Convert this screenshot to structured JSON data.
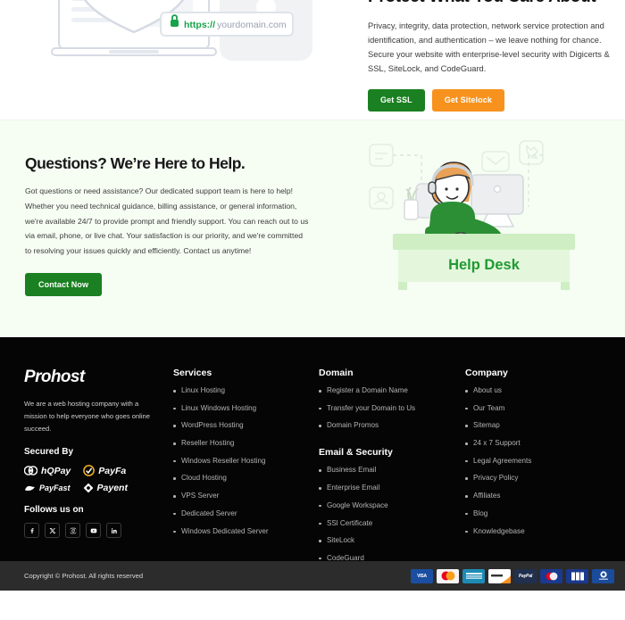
{
  "ssl_section": {
    "title": "Protect What You Care About",
    "paragraph": "Privacy, integrity, data protection, network service protection and identification, and authentication – we leave nothing for chance. Secure your website with enterprise-level security with Digicerts & SSL, SiteLock, and CodeGuard.",
    "primary_button": "Get SSL",
    "secondary_button": "Get Sitelock",
    "address_bar_text": "https://yourdomain.com",
    "address_bar_scheme": "https://",
    "address_bar_host": "yourdomain.com",
    "illustration_name": "laptop-shield-lock-illustration",
    "colors": {
      "primary": "#1a8021",
      "secondary": "#f7921e"
    }
  },
  "help_section": {
    "title": "Questions? We’re Here to Help.",
    "paragraph": "Got questions or need assistance? Our dedicated support team is here to help! Whether you need technical guidance, billing assistance, or general information, we're available 24/7 to provide prompt and friendly support. You can reach out to us via email, phone, or live chat. Your satisfaction is our priority, and we're committed to resolving your issues quickly and efficiently. Contact us anytime!",
    "button": "Contact Now",
    "desk_label": "Help Desk",
    "illustration_name": "help-desk-agent-illustration",
    "background": "#f6fdf3"
  },
  "footer": {
    "logo": "Prohost",
    "description": "We are a web hosting company with a mission to help everyone who goes online succeed.",
    "secured_by_heading": "Secured By",
    "secured_by": [
      {
        "name": "hqpay-logo",
        "label": "hQPay"
      },
      {
        "name": "payfa-logo",
        "label": "PayFa"
      },
      {
        "name": "payfast-logo",
        "label": "PayFast"
      },
      {
        "name": "payent-logo",
        "label": "Payent"
      }
    ],
    "follow_heading": "Follows us on",
    "social": [
      {
        "name": "facebook-icon",
        "label": "Facebook"
      },
      {
        "name": "x-twitter-icon",
        "label": "X"
      },
      {
        "name": "instagram-icon",
        "label": "Instagram"
      },
      {
        "name": "youtube-icon",
        "label": "YouTube"
      },
      {
        "name": "linkedin-icon",
        "label": "LinkedIn"
      }
    ],
    "columns": {
      "services": {
        "heading": "Services",
        "items": [
          "Linux Hosting",
          "Linux Windows Hosting",
          "WordPress Hosting",
          "Reseller Hosting",
          "Windows Reseller Hosting",
          "Cloud Hosting",
          "VPS Server",
          "Dedicated Server",
          "Windows Dedicated Server"
        ]
      },
      "domain": {
        "heading": "Domain",
        "items": [
          "Register a Domain Name",
          "Transfer your Domain to Us",
          "Domain Promos"
        ]
      },
      "email_security": {
        "heading": "Email & Security",
        "items": [
          "Business Email",
          "Enterprise Email",
          "Google Workspace",
          "SSl Certificate",
          "SiteLock",
          "CodeGuard"
        ]
      },
      "company": {
        "heading": "Company",
        "items": [
          "About us",
          "Our Team",
          "Sitemap",
          "24 x 7 Support",
          "Legal Agreements",
          "Privacy Policy",
          "Affiliates",
          "Blog",
          "Knowledgebase"
        ]
      }
    }
  },
  "bottom_bar": {
    "copyright": "Copyright © Prohost. All rights reserved",
    "payment_icons": [
      {
        "name": "visa-icon",
        "label": "VISA",
        "bg": "#1a4ea1",
        "fg": "#ffffff"
      },
      {
        "name": "mastercard-icon",
        "label": "",
        "bg": "#f5f5f5",
        "fg": "#222222"
      },
      {
        "name": "amex-icon",
        "label": "",
        "bg": "#1d8bb5",
        "fg": "#ffffff"
      },
      {
        "name": "discover-icon",
        "label": "DISCOVER",
        "bg": "#ffffff",
        "fg": "#222222"
      },
      {
        "name": "paypal-icon",
        "label": "PayPal",
        "bg": "#20304e",
        "fg": "#ffffff"
      },
      {
        "name": "maestro-icon",
        "label": "",
        "bg": "#1a3a8f",
        "fg": "#ffffff"
      },
      {
        "name": "jcb-icon",
        "label": "",
        "bg": "#1a3a8f",
        "fg": "#ffffff"
      },
      {
        "name": "diners-club-icon",
        "label": "",
        "bg": "#1a4c9b",
        "fg": "#ffffff"
      }
    ]
  }
}
